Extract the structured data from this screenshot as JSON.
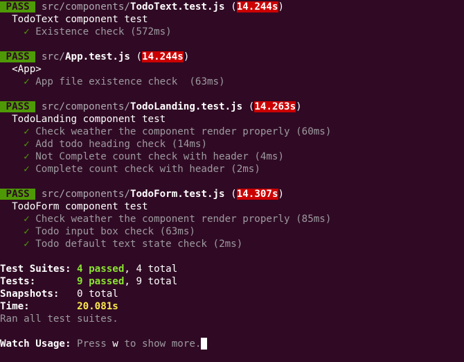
{
  "results": [
    {
      "status": "PASS",
      "dir": "src/components/",
      "file": "TodoText.test.js",
      "time": "14.244s",
      "suite": "TodoText component test",
      "tests": [
        {
          "name": "Existence check",
          "duration": "(572ms)"
        }
      ]
    },
    {
      "status": "PASS",
      "dir": "src/",
      "file": "App.test.js",
      "time": "14.244s",
      "suite": "<App>",
      "tests": [
        {
          "name": "App file existence check ",
          "duration": "(63ms)"
        }
      ]
    },
    {
      "status": "PASS",
      "dir": "src/components/",
      "file": "TodoLanding.test.js",
      "time": "14.263s",
      "suite": "TodoLanding component test",
      "tests": [
        {
          "name": "Check weather the component render properly",
          "duration": "(60ms)"
        },
        {
          "name": "Add todo heading check",
          "duration": "(14ms)"
        },
        {
          "name": "Not Complete count check with header",
          "duration": "(4ms)"
        },
        {
          "name": "Complete count check with header",
          "duration": "(2ms)"
        }
      ]
    },
    {
      "status": "PASS",
      "dir": "src/components/",
      "file": "TodoForm.test.js",
      "time": "14.307s",
      "suite": "TodoForm component test",
      "tests": [
        {
          "name": "Check weather the component render properly",
          "duration": "(85ms)"
        },
        {
          "name": "Todo input box check",
          "duration": "(63ms)"
        },
        {
          "name": "Todo default text state check",
          "duration": "(2ms)"
        }
      ]
    }
  ],
  "check_glyph": "✓",
  "summary": {
    "suites_label": "Test Suites:",
    "suites_passed": "4 passed",
    "suites_total": ", 4 total",
    "tests_label": "Tests:",
    "tests_passed": "9 passed",
    "tests_total": ", 9 total",
    "snapshots_label": "Snapshots:",
    "snapshots_value": "0 total",
    "time_label": "Time:",
    "time_value": "20.081s",
    "ran_all": "Ran all test suites."
  },
  "watch": {
    "label": "Watch Usage:",
    "pre": " Press ",
    "key": "w",
    "post": " to show more."
  },
  "colors": {
    "background": "#300a24",
    "pass_bg": "#4e9a06",
    "slow_bg": "#cc0000",
    "green": "#8ae234",
    "yellow": "#fce94f"
  }
}
